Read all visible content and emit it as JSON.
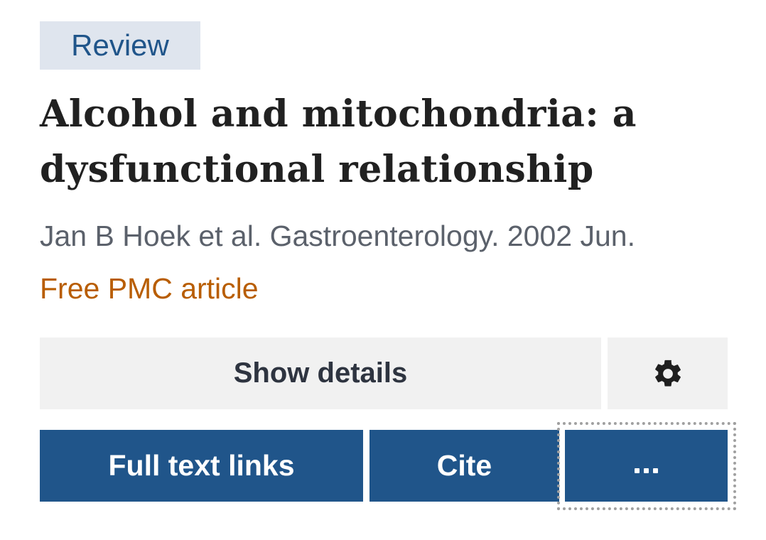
{
  "article": {
    "badge": "Review",
    "title": "Alcohol and mitochondria: a dysfunctional relationship",
    "citation": "Jan B Hoek et al. Gastroenterology. 2002 Jun.",
    "free_link": "Free PMC article"
  },
  "actions": {
    "show_details_label": "Show details",
    "settings_icon": "gear-icon",
    "full_text_label": "Full text links",
    "cite_label": "Cite",
    "more_label": "...",
    "more_focused": true
  },
  "colors": {
    "brand_blue": "#20558a",
    "badge_bg": "#dfe5ee",
    "free_article": "#b85d00",
    "gray_button": "#f1f1f1",
    "title_text": "#212121",
    "meta_text": "#5b616b"
  }
}
